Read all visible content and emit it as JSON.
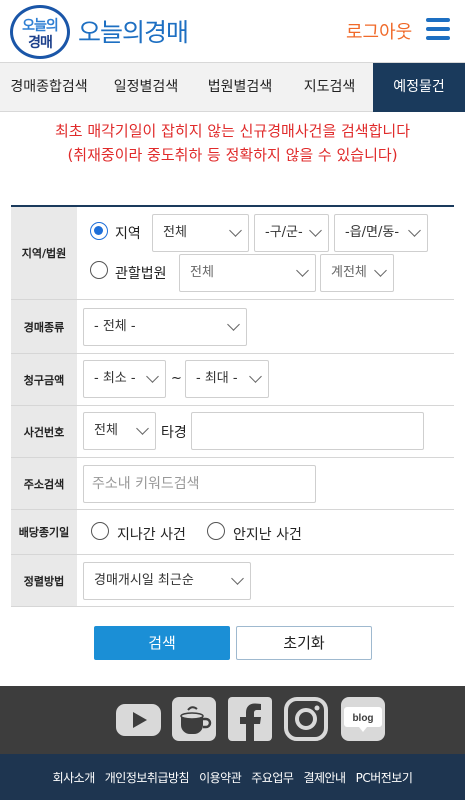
{
  "header": {
    "logo_line1": "오늘의",
    "logo_line2": "경매",
    "brand": "오늘의경매",
    "logout_label": "로그아웃",
    "menu_icon": "hamburger-menu-icon"
  },
  "tabs": [
    {
      "label": "경매종합검색"
    },
    {
      "label": "일정별검색"
    },
    {
      "label": "법원별검색"
    },
    {
      "label": "지도검색"
    },
    {
      "label": "예정물건",
      "active": true
    }
  ],
  "notice": {
    "line1": "최초 매각기일이 잡히지 않는 신규경매사건을 검색합니다",
    "line2": "(취재중이라 중도취하 등 정확하지 않을 수 있습니다)"
  },
  "form": {
    "region": {
      "label": "지역/법원",
      "opt_region": "지역",
      "opt_court": "관할법원",
      "selected": "지역",
      "sido": "전체",
      "gugun": "-구/군-",
      "dong": "-읍/면/동-",
      "court": "전체",
      "court_dept": "계전체"
    },
    "kind": {
      "label": "경매종류",
      "value": "- 전체 -"
    },
    "amount": {
      "label": "청구금액",
      "min": "- 최소 -",
      "tilde": "~",
      "max": "- 최대 -"
    },
    "case_no": {
      "label": "사건번호",
      "year": "전체",
      "suffix": "타경",
      "value": ""
    },
    "address": {
      "label": "주소검색",
      "placeholder": "주소내 키워드검색",
      "value": ""
    },
    "dividend": {
      "label": "배당종기일",
      "opt_past": "지나간 사건",
      "opt_future": "안지난 사건"
    },
    "sort": {
      "label": "정렬방법",
      "value": "경매개시일 최근순"
    }
  },
  "buttons": {
    "search": "검색",
    "reset": "초기화"
  },
  "social": [
    "youtube-icon",
    "cafe-icon",
    "facebook-icon",
    "instagram-icon",
    "blog-icon"
  ],
  "social_blog_text": "blog",
  "footer_links": [
    "회사소개",
    "개인정보취급방침",
    "이용약관",
    "주요업무",
    "결제안내",
    "PC버전보기"
  ],
  "colors": {
    "brand_blue": "#1d6fc2",
    "logout_orange": "#f06a2a",
    "active_tab": "#1a3a5c",
    "notice_red": "#e02b2b",
    "search_button": "#1b8fd6",
    "footer_dark": "#3d3d3d",
    "footer_navy": "#1e3550"
  }
}
